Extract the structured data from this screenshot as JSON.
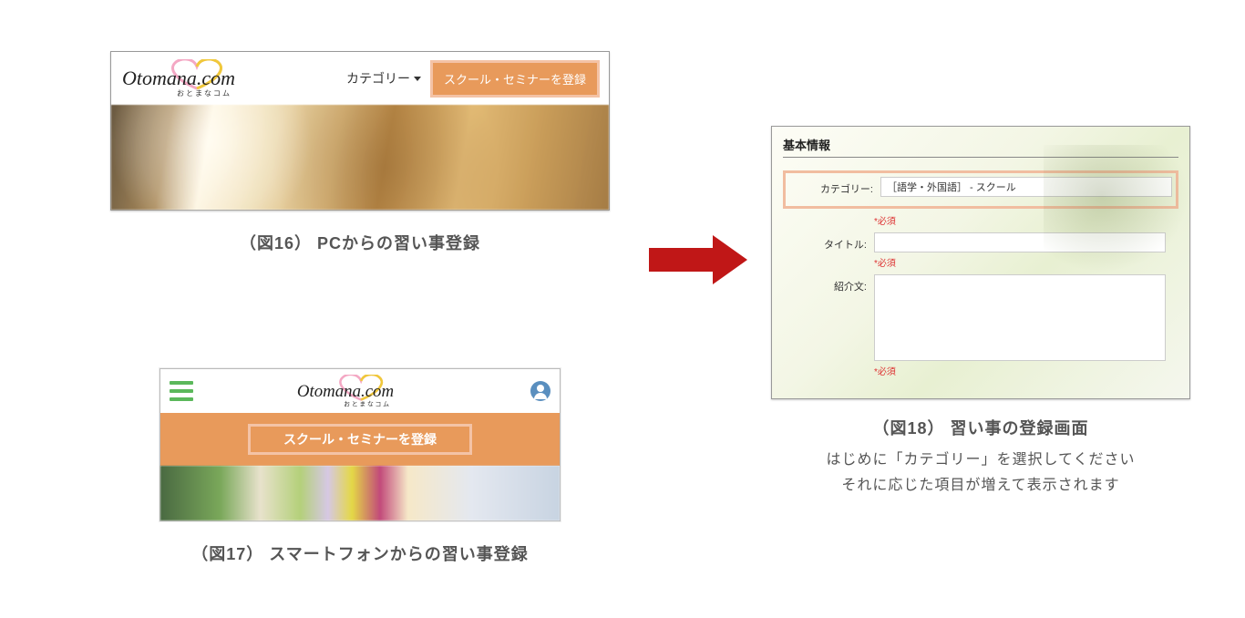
{
  "logo": {
    "main": "Otomana.com",
    "sub": "おとまなコム"
  },
  "fig16": {
    "category_label": "カテゴリー",
    "register_btn": "スクール・セミナーを登録",
    "caption": "（図16） PCからの習い事登録"
  },
  "fig17": {
    "register_btn": "スクール・セミナーを登録",
    "caption": "（図17） スマートフォンからの習い事登録"
  },
  "fig18": {
    "section_title": "基本情報",
    "rows": {
      "category": {
        "label": "カテゴリー:",
        "value": "［語学・外国語］  -  スクール",
        "required": "*必須"
      },
      "title": {
        "label": "タイトル:",
        "required": "*必須"
      },
      "intro": {
        "label": "紹介文:",
        "required": "*必須"
      }
    },
    "caption1": "（図18） 習い事の登録画面",
    "caption2": "はじめに「カテゴリー」を選択してください",
    "caption3": "それに応じた項目が増えて表示されます"
  }
}
